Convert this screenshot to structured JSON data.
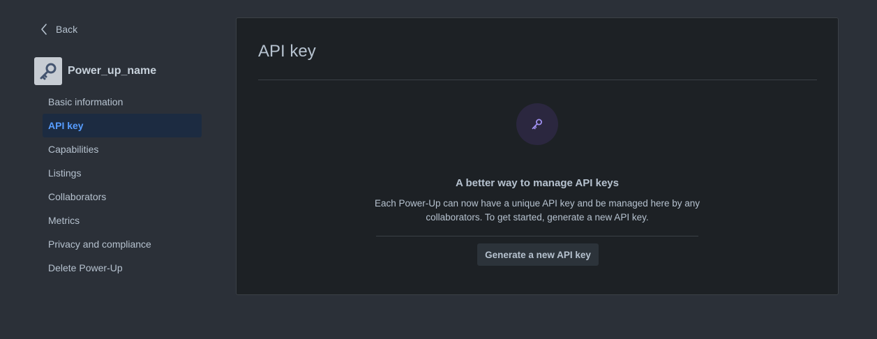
{
  "sidebar": {
    "back_label": "Back",
    "app_name": "Power_up_name",
    "app_icon": "key-icon",
    "items": [
      {
        "label": "Basic information",
        "active": false
      },
      {
        "label": "API key",
        "active": true
      },
      {
        "label": "Capabilities",
        "active": false
      },
      {
        "label": "Listings",
        "active": false
      },
      {
        "label": "Collaborators",
        "active": false
      },
      {
        "label": "Metrics",
        "active": false
      },
      {
        "label": "Privacy and compliance",
        "active": false
      },
      {
        "label": "Delete Power-Up",
        "active": false
      }
    ]
  },
  "main": {
    "title": "API key",
    "empty_state": {
      "icon": "key-icon",
      "heading": "A better way to manage API keys",
      "description": "Each Power-Up can now have a unique API key and be managed here by any collaborators. To get started, generate a new API key.",
      "button_label": "Generate a new API key"
    }
  },
  "colors": {
    "background": "#2b3038",
    "panel": "#1d2125",
    "accent": "#579dff",
    "active_bg": "#1c2b41",
    "icon_purple": "#9f8fef"
  }
}
